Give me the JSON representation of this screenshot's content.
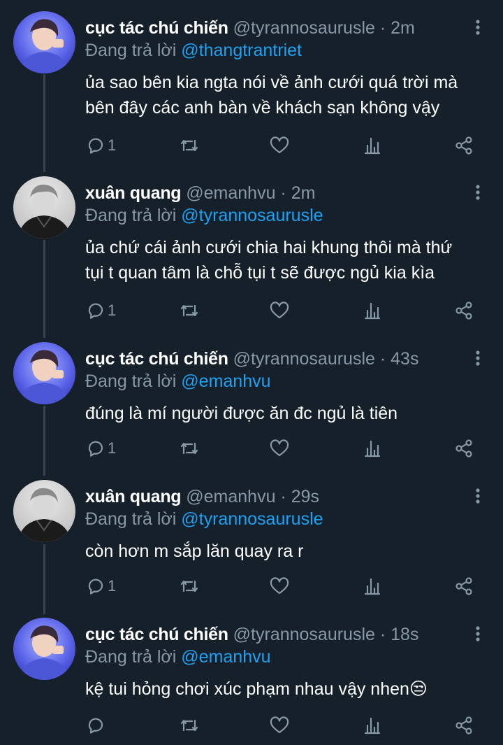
{
  "tweets": [
    {
      "name": "cục tác chú chiến",
      "handle": "@tyrannosaurusle · 2m",
      "reply_prefix": "Đang trả lời ",
      "reply_to": "@thangtrantriet",
      "line1": "ủa sao bên kia ngta nói về ảnh cưới quá trời mà",
      "line2": "bên đây các anh bàn về khách sạn không vậy",
      "reply_count": "1",
      "avatar": "blue-avatar"
    },
    {
      "name": "xuân quang",
      "handle": "@emanhvu · 2m",
      "reply_prefix": "Đang trả lời ",
      "reply_to": "@tyrannosaurusle",
      "line1": "ủa chứ cái ảnh cưới chia hai khung thôi mà thứ",
      "line2": "tụi t quan tâm là chỗ tụi t sẽ được ngủ kia kìa",
      "reply_count": "1",
      "avatar": "bw-avatar"
    },
    {
      "name": "cục tác chú chiến",
      "handle": "@tyrannosaurusle · 43s",
      "reply_prefix": "Đang trả lời ",
      "reply_to": "@emanhvu",
      "line1": "đúng là mí người được ăn đc ngủ là tiên",
      "reply_count": "1",
      "avatar": "blue-avatar"
    },
    {
      "name": "xuân quang",
      "handle": "@emanhvu · 29s",
      "reply_prefix": "Đang trả lời ",
      "reply_to": "@tyrannosaurusle",
      "line1": "còn hơn m sắp lăn quay ra r",
      "reply_count": "1",
      "avatar": "bw-avatar"
    },
    {
      "name": "cục tác chú chiến",
      "handle": "@tyrannosaurusle · 18s",
      "reply_prefix": "Đang trả lời ",
      "reply_to": "@emanhvu",
      "line1": "kệ tui hỏng chơi xúc phạm nhau vậy nhen😒",
      "reply_count": "",
      "avatar": "blue-avatar"
    }
  ],
  "icons": {
    "reply": "comment-icon",
    "retweet": "retweet-icon",
    "like": "heart-icon",
    "stats": "analytics-icon",
    "share": "share-icon",
    "more": "more-vertical-icon"
  },
  "colors": {
    "background": "#15202b",
    "secondary_text": "#8899a6",
    "mention": "#1da1f2",
    "thread_line": "#38444d"
  }
}
